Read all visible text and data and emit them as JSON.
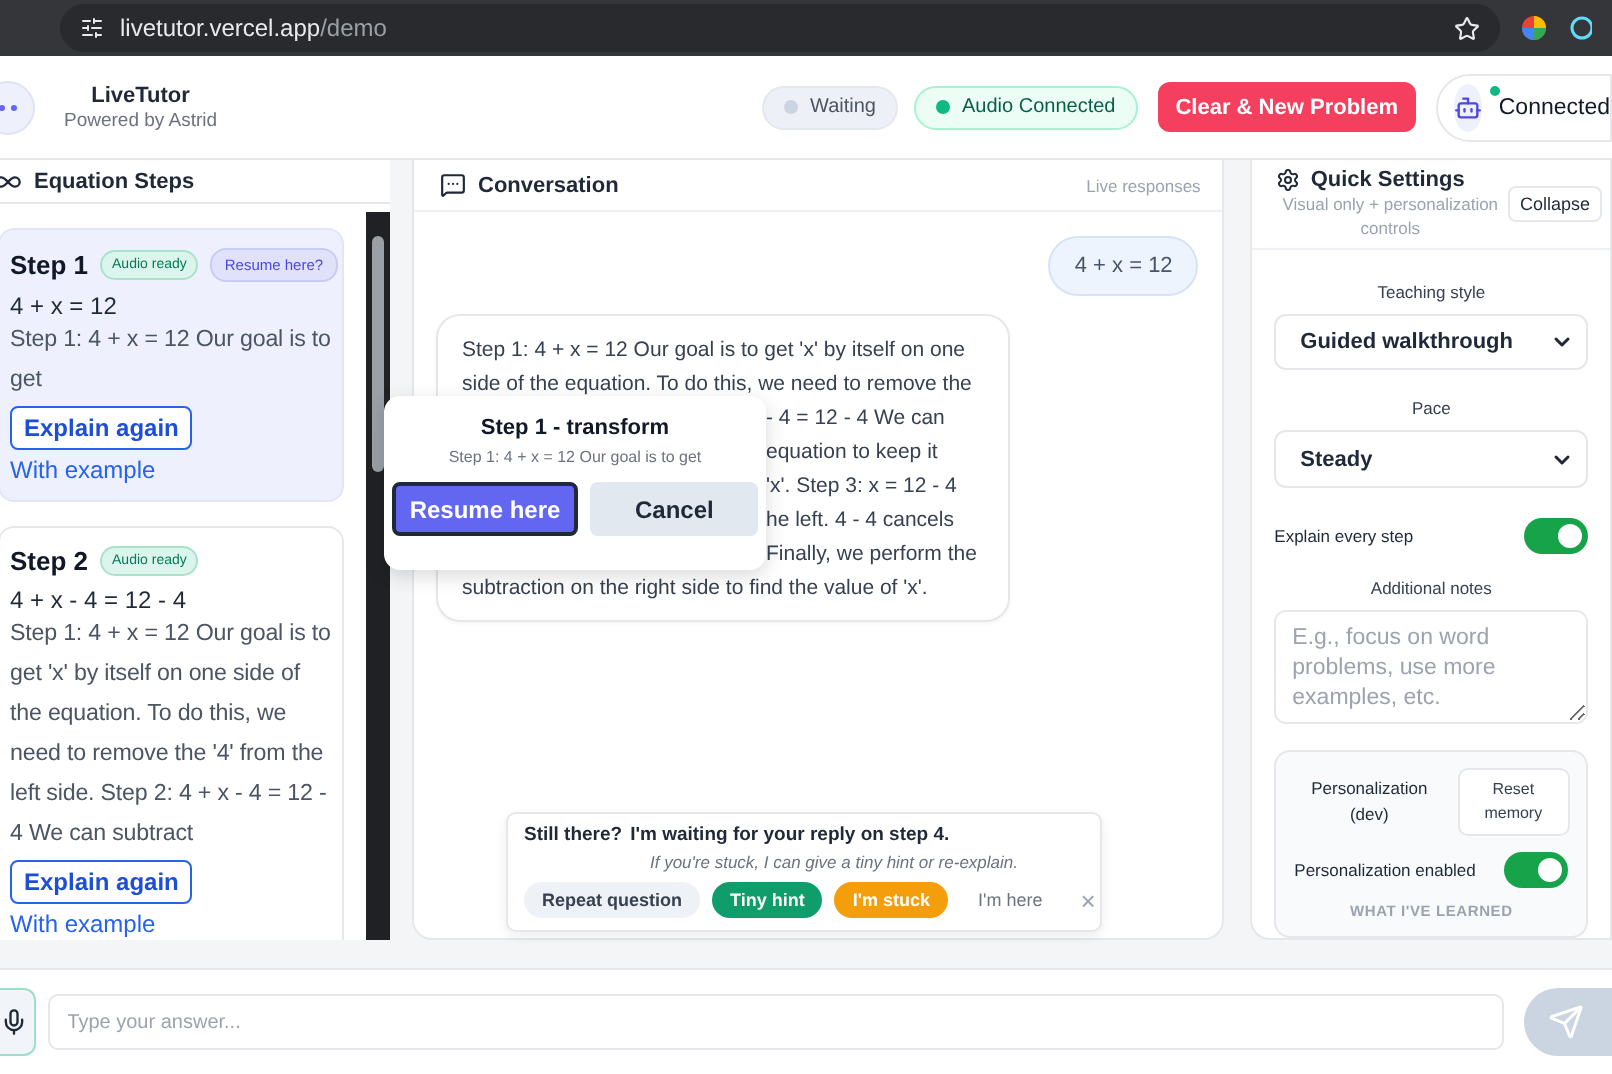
{
  "browser": {
    "url_host": "livetutor.vercel.app",
    "url_path": "/demo"
  },
  "header": {
    "title": "LiveTutor",
    "subtitle": "Powered by Astrid",
    "statuses": [
      {
        "label": "Waiting",
        "color": "#cbd5e1",
        "kind": "neutral"
      },
      {
        "label": "Audio Connected",
        "color": "#10b981",
        "kind": "success"
      }
    ],
    "primary_button": "Clear & New Problem",
    "connection": {
      "label": "Connected",
      "online": true
    }
  },
  "steps_panel": {
    "title": "Equation Steps",
    "steps": [
      {
        "title": "Step 1",
        "badge": "Audio ready",
        "resume_badge": "Resume here?",
        "selected": true,
        "equation": "4 + x = 12",
        "explanation": "Step 1: 4 + x = 12 Our goal is to get",
        "button": "Explain again",
        "link": "With example"
      },
      {
        "title": "Step 2",
        "badge": "Audio ready",
        "selected": false,
        "equation": "4 + x - 4 = 12 - 4",
        "explanation": "Step 1: 4 + x = 12 Our goal is to get 'x' by itself on one side of the equation. To do this, we need to remove the '4' from the left side. Step 2: 4 + x - 4 = 12 - 4 We can subtract",
        "button": "Explain again",
        "link": "With example"
      }
    ]
  },
  "conversation": {
    "title": "Conversation",
    "hint": "Live responses",
    "messages": [
      {
        "kind": "user",
        "lines": [
          {
            "text": "4 + x = 12",
            "covered": false
          }
        ]
      },
      {
        "kind": "assistant",
        "lines": [
          {
            "text": "Step 1: 4 + x = 12 Our goal is to get 'x' by itself on one",
            "covered": false
          },
          {
            "text": "side of the equation. To do this, we need to remove the",
            "covered": false
          },
          {
            "text": "- 4 = 12 - 4 We can",
            "covered": true
          },
          {
            "text": "equation to keep it",
            "covered": true
          },
          {
            "text": "'x'. Step 3: x = 12 - 4",
            "covered": true
          },
          {
            "text": "he left. 4 - 4 cancels",
            "covered": true
          },
          {
            "text": "Finally, we perform the",
            "covered": true
          },
          {
            "text": "subtraction on the right side to find the value of 'x'.",
            "covered": false
          }
        ]
      }
    ],
    "nudge": {
      "lead": "Still there?",
      "message": "I'm waiting for your reply on step 4.",
      "hint": "If you're stuck, I can give a tiny hint or re-explain.",
      "actions": [
        {
          "label": "Repeat question",
          "kind": "neutral"
        },
        {
          "label": "Tiny hint",
          "kind": "success"
        },
        {
          "label": "I'm stuck",
          "kind": "warning"
        },
        {
          "label": "I'm here",
          "kind": "plain"
        }
      ],
      "close": "×"
    }
  },
  "resume_popover": {
    "title": "Step 1 - transform",
    "preview": "Step 1: 4 + x = 12 Our goal is to get",
    "confirm": "Resume here",
    "cancel": "Cancel"
  },
  "settings": {
    "title": "Quick Settings",
    "subtitle": "Visual only + personalization controls",
    "collapse": "Collapse",
    "teaching_style": {
      "label": "Teaching style",
      "value": "Guided walkthrough"
    },
    "pace": {
      "label": "Pace",
      "value": "Steady"
    },
    "explain_every_step": {
      "label": "Explain every step",
      "on": true
    },
    "notes": {
      "label": "Additional notes",
      "placeholder": "E.g., focus on word problems, use more examples, etc."
    },
    "personalization": {
      "title": "Personalization (dev)",
      "reset": "Reset memory",
      "toggle": {
        "label": "Personalization enabled",
        "on": true
      },
      "learned_heading": "WHAT I'VE LEARNED"
    }
  },
  "composer": {
    "placeholder": "Type your answer..."
  }
}
